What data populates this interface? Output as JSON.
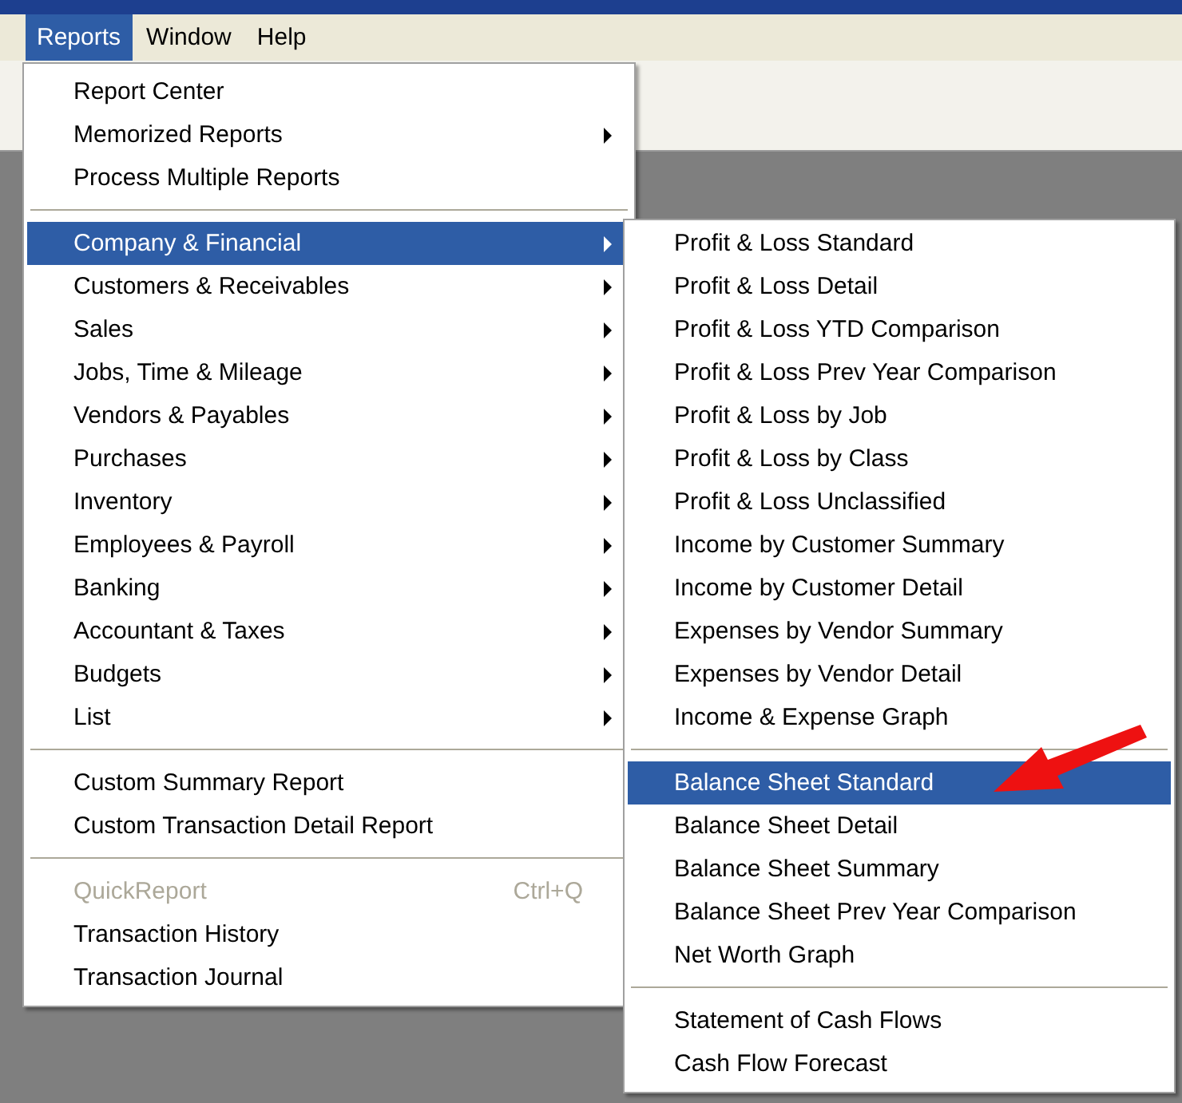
{
  "menubar": [
    {
      "label": "Reports",
      "selected": true
    },
    {
      "label": "Window",
      "selected": false
    },
    {
      "label": "Help",
      "selected": false
    }
  ],
  "menu": {
    "sections": [
      {
        "items": [
          {
            "label": "Report Center",
            "submenu": false,
            "disabled": false,
            "selected": false
          },
          {
            "label": "Memorized Reports",
            "submenu": true,
            "disabled": false,
            "selected": false
          },
          {
            "label": "Process Multiple Reports",
            "submenu": false,
            "disabled": false,
            "selected": false
          }
        ]
      },
      {
        "items": [
          {
            "label": "Company & Financial",
            "submenu": true,
            "disabled": false,
            "selected": true
          },
          {
            "label": "Customers & Receivables",
            "submenu": true,
            "disabled": false,
            "selected": false
          },
          {
            "label": "Sales",
            "submenu": true,
            "disabled": false,
            "selected": false
          },
          {
            "label": "Jobs, Time & Mileage",
            "submenu": true,
            "disabled": false,
            "selected": false
          },
          {
            "label": "Vendors & Payables",
            "submenu": true,
            "disabled": false,
            "selected": false
          },
          {
            "label": "Purchases",
            "submenu": true,
            "disabled": false,
            "selected": false
          },
          {
            "label": "Inventory",
            "submenu": true,
            "disabled": false,
            "selected": false
          },
          {
            "label": "Employees & Payroll",
            "submenu": true,
            "disabled": false,
            "selected": false
          },
          {
            "label": "Banking",
            "submenu": true,
            "disabled": false,
            "selected": false
          },
          {
            "label": "Accountant & Taxes",
            "submenu": true,
            "disabled": false,
            "selected": false
          },
          {
            "label": "Budgets",
            "submenu": true,
            "disabled": false,
            "selected": false
          },
          {
            "label": "List",
            "submenu": true,
            "disabled": false,
            "selected": false
          }
        ]
      },
      {
        "items": [
          {
            "label": "Custom Summary Report",
            "submenu": false,
            "disabled": false,
            "selected": false
          },
          {
            "label": "Custom Transaction Detail Report",
            "submenu": false,
            "disabled": false,
            "selected": false
          }
        ]
      },
      {
        "items": [
          {
            "label": "QuickReport",
            "shortcut": "Ctrl+Q",
            "submenu": false,
            "disabled": true,
            "selected": false
          },
          {
            "label": "Transaction History",
            "submenu": false,
            "disabled": false,
            "selected": false
          },
          {
            "label": "Transaction Journal",
            "submenu": false,
            "disabled": false,
            "selected": false
          }
        ]
      }
    ]
  },
  "submenu": {
    "sections": [
      {
        "items": [
          {
            "label": "Profit & Loss Standard",
            "selected": false
          },
          {
            "label": "Profit & Loss Detail",
            "selected": false
          },
          {
            "label": "Profit & Loss YTD Comparison",
            "selected": false
          },
          {
            "label": "Profit & Loss Prev Year Comparison",
            "selected": false
          },
          {
            "label": "Profit & Loss by Job",
            "selected": false
          },
          {
            "label": "Profit & Loss by Class",
            "selected": false
          },
          {
            "label": "Profit & Loss Unclassified",
            "selected": false
          },
          {
            "label": "Income by Customer Summary",
            "selected": false
          },
          {
            "label": "Income by Customer Detail",
            "selected": false
          },
          {
            "label": "Expenses by Vendor Summary",
            "selected": false
          },
          {
            "label": "Expenses by Vendor Detail",
            "selected": false
          },
          {
            "label": "Income & Expense Graph",
            "selected": false
          }
        ]
      },
      {
        "items": [
          {
            "label": "Balance Sheet Standard",
            "selected": true
          },
          {
            "label": "Balance Sheet Detail",
            "selected": false
          },
          {
            "label": "Balance Sheet Summary",
            "selected": false
          },
          {
            "label": "Balance Sheet Prev Year Comparison",
            "selected": false
          },
          {
            "label": "Net Worth Graph",
            "selected": false
          }
        ]
      },
      {
        "items": [
          {
            "label": "Statement of Cash Flows",
            "selected": false
          },
          {
            "label": "Cash Flow Forecast",
            "selected": false
          }
        ]
      }
    ]
  }
}
